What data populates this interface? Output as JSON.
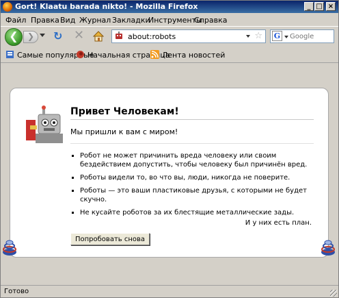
{
  "window": {
    "title": "Gort! Klaatu barada nikto! - Mozilla Firefox",
    "controls": {
      "minimize": "_",
      "maximize": "□",
      "close": "×"
    }
  },
  "menu": [
    "Файл",
    "Правка",
    "Вид",
    "Журнал",
    "Закладки",
    "Инструменты",
    "Справка"
  ],
  "navigation": {
    "back_icon": "arrow-left-icon",
    "forward_icon": "arrow-right-icon",
    "reload_icon": "reload-icon",
    "stop_icon": "stop-icon",
    "home_icon": "home-icon",
    "url": "about:robots",
    "search_engine": "G",
    "search_placeholder": "Google"
  },
  "bookmarks": [
    {
      "label": "Самые популярные",
      "icon": "bookmark-icon"
    },
    {
      "label": "Начальная страница",
      "icon": "firefox-icon"
    },
    {
      "label": "Лента новостей",
      "icon": "rss-icon"
    }
  ],
  "page": {
    "title": "Привет Человекам!",
    "lead": "Мы пришли к вам с миром!",
    "items": [
      "Робот не может причинить вреда человеку или своим бездействием допустить, чтобы человеку был причинён вред.",
      "Роботы видели то, во что вы, люди, никогда не поверите.",
      "Роботы — это ваши пластиковые друзья, с которыми не будет скучно.",
      "Не кусайте роботов за их блестящие металлические зады."
    ],
    "footnote": "И у них есть план.",
    "try_again": "Попробовать снова"
  },
  "status": "Готово",
  "colors": {
    "titlebar": "#0a246a",
    "chrome": "#d4d0c8",
    "accent_green": "#3c9a2a"
  }
}
